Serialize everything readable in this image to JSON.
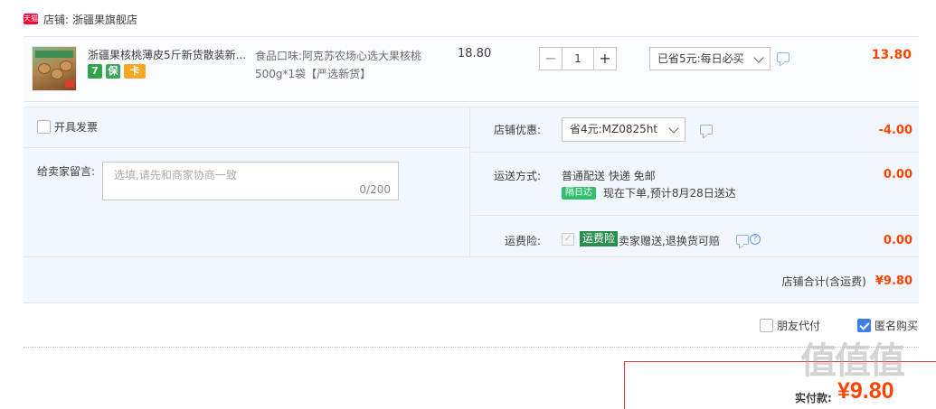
{
  "shop": {
    "badge": "天猫",
    "label": "店铺:",
    "name": "浙疆果旗舰店"
  },
  "item": {
    "title": "浙疆果核桃薄皮5斤新货散装新...",
    "badges": [
      "7",
      "保",
      "卡"
    ],
    "sku": "食品口味:阿克苏农场心选大果核桃500g*1袋【严选新货】",
    "unit_price": "18.80",
    "quantity": "1",
    "qty_minus": "−",
    "qty_plus": "+",
    "promo": "已省5元:每日必买",
    "subtotal": "13.80"
  },
  "invoice": {
    "label": "开具发票"
  },
  "memo": {
    "label": "给卖家留言:",
    "placeholder": "选填,请先和商家协商一致",
    "counter": "0/200"
  },
  "coupon": {
    "label": "店铺优惠:",
    "value": "省4元:MZ0825ht",
    "amount": "-4.00"
  },
  "delivery": {
    "label": "运送方式:",
    "method": "普通配送 快递 免邮",
    "badge": "隔日达",
    "estimate": "现在下单,预计8月28日送达",
    "amount": "0.00"
  },
  "insurance": {
    "label": "运费险:",
    "checkmark": "✓",
    "badge": "运费险",
    "desc": "卖家赠送,退换货可赔",
    "help": "?",
    "amount": "0.00"
  },
  "shop_total": {
    "label": "店铺合计(含运费)",
    "value": "¥9.80"
  },
  "options": {
    "friend_pay": "朋友代付",
    "anonymous": "匿名购买"
  },
  "payment": {
    "label": "实付款:",
    "value": "¥9.80"
  },
  "watermark": "值值值"
}
